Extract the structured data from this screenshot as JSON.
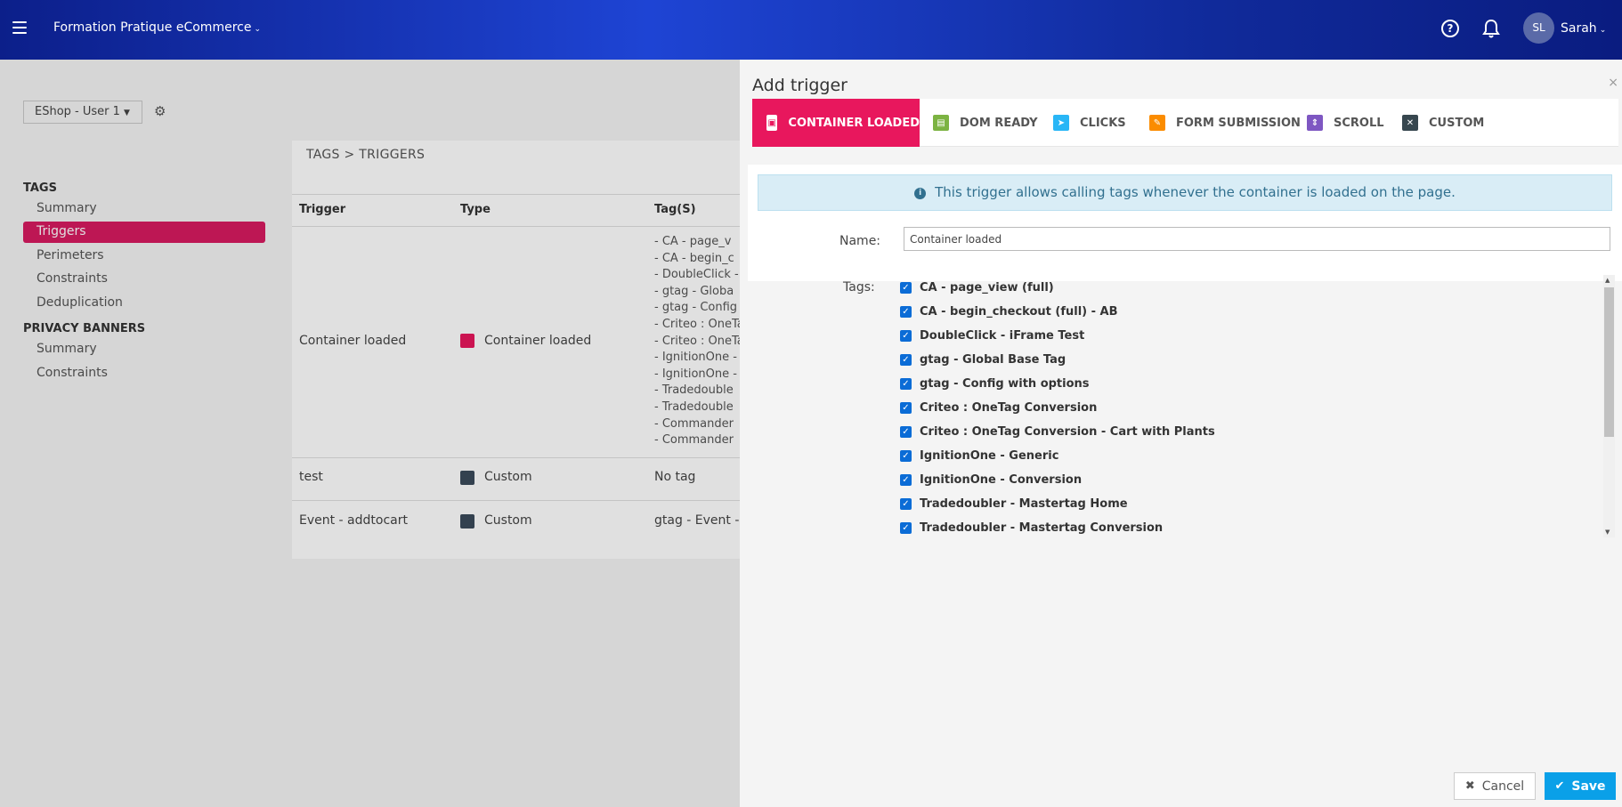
{
  "header": {
    "app_title": "Formation Pratique eCommerce",
    "user_initials": "SL",
    "user_name": "Sarah"
  },
  "sidebar": {
    "workspace": "EShop - User 1",
    "sections": [
      {
        "title": "TAGS",
        "items": [
          "Summary",
          "Triggers",
          "Perimeters",
          "Constraints",
          "Deduplication"
        ]
      },
      {
        "title": "PRIVACY BANNERS",
        "items": [
          "Summary",
          "Constraints"
        ]
      }
    ],
    "active_item": "Triggers"
  },
  "main": {
    "breadcrumb": "TAGS > TRIGGERS",
    "columns": [
      "Trigger",
      "Type",
      "Tag(S)"
    ],
    "rows": [
      {
        "trigger": "Container loaded",
        "type": "Container loaded",
        "tags": [
          "- CA - page_v",
          "- CA - begin_c",
          "- DoubleClick -",
          "- gtag - Globa",
          "- gtag - Config",
          "- Criteo : OneTa",
          "- Criteo : OneTa",
          "- IgnitionOne -",
          "- IgnitionOne -",
          "- Tradedouble",
          "- Tradedouble",
          "- Commander",
          "- Commander"
        ]
      },
      {
        "trigger": "test",
        "type": "Custom",
        "tags_text": "No tag"
      },
      {
        "trigger": "Event - addtocart",
        "type": "Custom",
        "tags_text": "gtag - Event -"
      }
    ]
  },
  "drawer": {
    "title": "Add trigger",
    "close": "×",
    "tabs": [
      "CONTAINER LOADED",
      "DOM READY",
      "CLICKS",
      "FORM SUBMISSION",
      "SCROLL",
      "CUSTOM"
    ],
    "active_tab": "CONTAINER LOADED",
    "info": "This trigger allows calling tags whenever the container is loaded on the page.",
    "name_label": "Name:",
    "name_value": "Container loaded",
    "tags_label": "Tags:",
    "tags": [
      "CA - page_view (full)",
      "CA - begin_checkout (full) - AB",
      "DoubleClick - iFrame Test",
      "gtag - Global Base Tag",
      "gtag - Config with options",
      "Criteo : OneTag Conversion",
      "Criteo : OneTag Conversion - Cart with Plants",
      "IgnitionOne - Generic",
      "IgnitionOne - Conversion",
      "Tradedoubler - Mastertag Home",
      "Tradedoubler - Mastertag Conversion"
    ],
    "cancel_label": "Cancel",
    "save_label": "Save"
  },
  "colors": {
    "accent": "#e8175d",
    "save": "#0aa0e8",
    "checkbox": "#0b6cd6",
    "info_bg": "#d9edf6"
  }
}
